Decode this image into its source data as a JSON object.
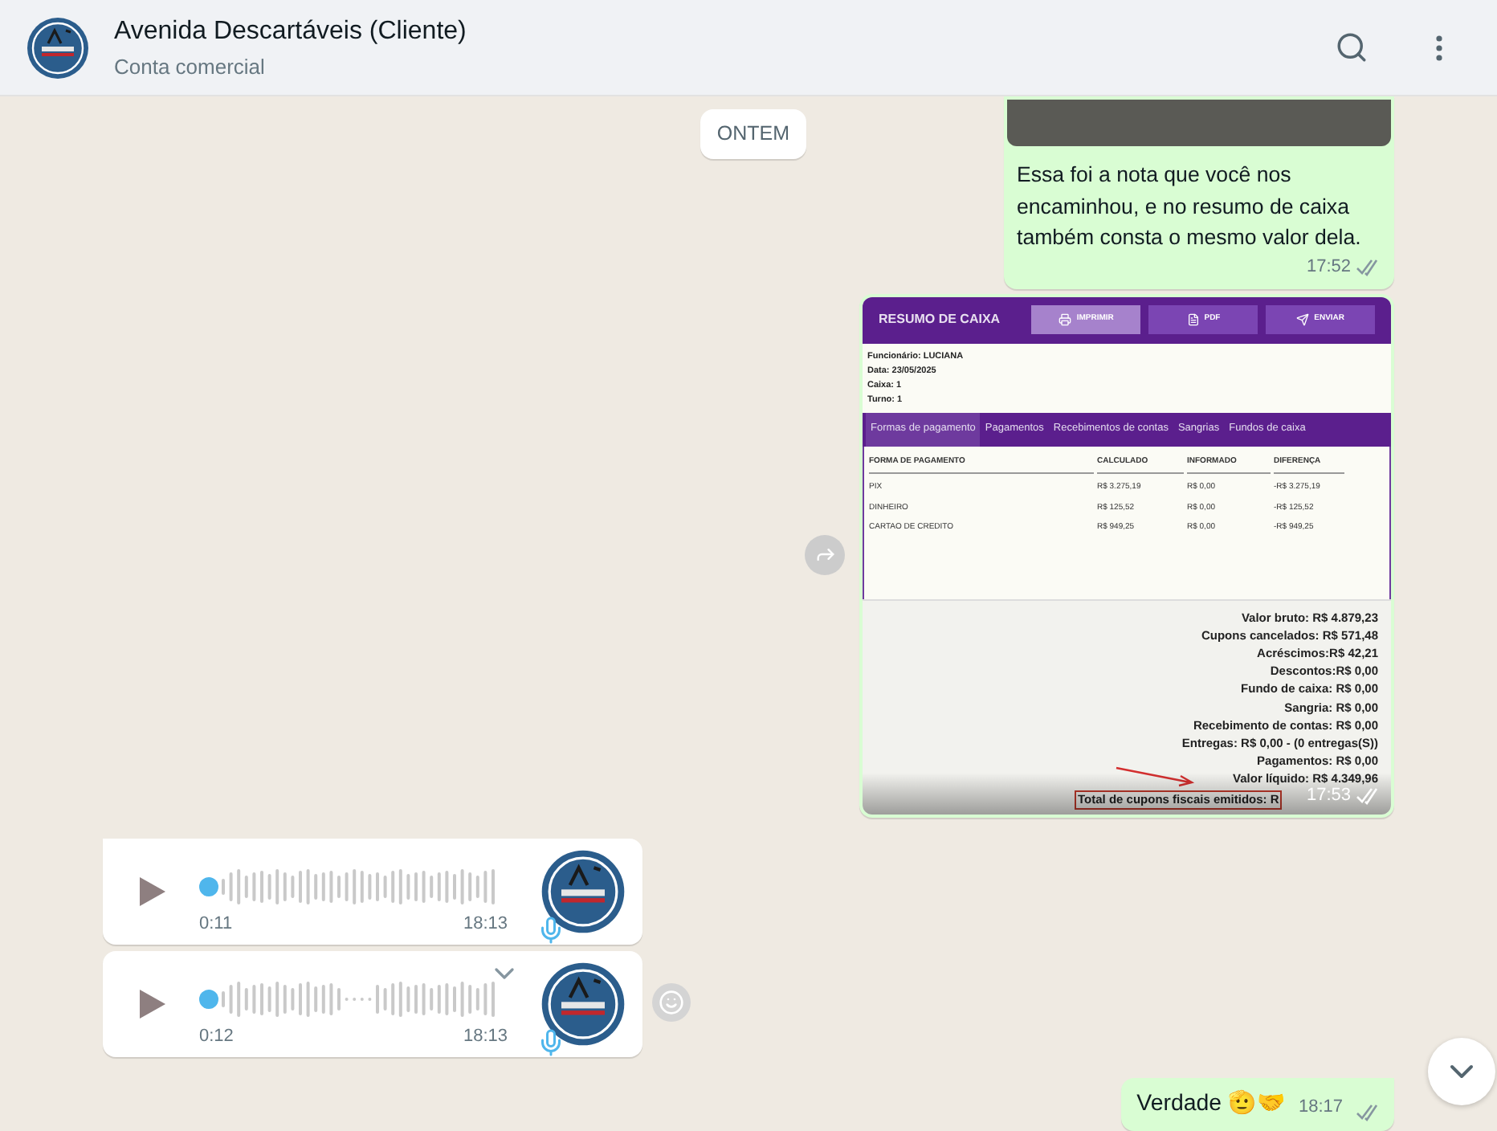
{
  "header": {
    "title": "Avenida Descartáveis (Cliente)",
    "subtitle": "Conta comercial"
  },
  "date_chip": "ONTEM",
  "messages": [
    {
      "kind": "text_with_photo",
      "outgoing": true,
      "text": "Essa foi a nota que você nos encaminhou, e no resumo de caixa também consta o mesmo valor dela.",
      "time": "17:52",
      "read": false
    },
    {
      "kind": "screenshot",
      "outgoing": true,
      "time": "17:53",
      "read": false,
      "screenshot": {
        "title": "RESUMO DE CAIXA",
        "buttons": [
          {
            "label": "IMPRIMIR",
            "selected": true
          },
          {
            "label": "PDF",
            "selected": false
          },
          {
            "label": "ENVIAR",
            "selected": false
          }
        ],
        "info": [
          "Funcionário: LUCIANA",
          "Data: 23/05/2025",
          "Caixa: 1",
          "Turno: 1"
        ],
        "tabs": [
          {
            "label": "Formas de pagamento",
            "selected": true
          },
          {
            "label": "Pagamentos",
            "selected": false
          },
          {
            "label": "Recebimentos de contas",
            "selected": false
          },
          {
            "label": "Sangrias",
            "selected": false
          },
          {
            "label": "Fundos de caixa",
            "selected": false
          }
        ],
        "columns": [
          "FORMA DE PAGAMENTO",
          "CALCULADO",
          "INFORMADO",
          "DIFERENÇA"
        ],
        "rows": [
          [
            "PIX",
            "R$ 3.275,19",
            "R$ 0,00",
            "-R$ 3.275,19"
          ],
          [
            "DINHEIRO",
            "R$ 125,52",
            "R$ 0,00",
            "-R$ 125,52"
          ],
          [
            "CARTAO DE CREDITO",
            "R$ 949,25",
            "R$ 0,00",
            "-R$ 949,25"
          ]
        ],
        "summary": [
          "Valor bruto: R$ 4.879,23",
          "Cupons cancelados: R$ 571,48",
          "Acréscimos:R$ 42,21",
          "Descontos:R$ 0,00",
          "Fundo de caixa: R$ 0,00",
          "Sangria: R$ 0,00",
          "Recebimento de contas: R$ 0,00",
          "Entregas: R$ 0,00 - (0 entregas(S))",
          "Pagamentos: R$ 0,00",
          "Valor líquido: R$ 4.349,96"
        ],
        "highlighted_line": "Total de cupons fiscais emitidos: R"
      }
    },
    {
      "kind": "voice",
      "outgoing": false,
      "duration": "0:11",
      "time": "18:13",
      "menu_shown": false
    },
    {
      "kind": "voice",
      "outgoing": false,
      "duration": "0:12",
      "time": "18:13",
      "menu_shown": true
    },
    {
      "kind": "text",
      "outgoing": true,
      "text": "Verdade 🫡🤝",
      "time": "18:17",
      "read": false
    }
  ]
}
